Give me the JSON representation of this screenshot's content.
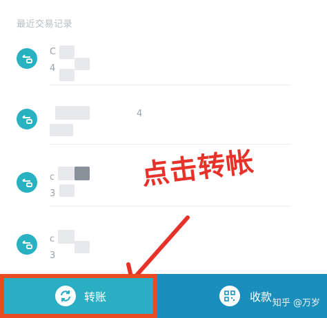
{
  "recent": {
    "title": "最近交易记录",
    "records": [
      {
        "name_fragment": "C",
        "sub_fragment": "4",
        "extra_fragment": ""
      },
      {
        "name_fragment": "",
        "sub_fragment": "",
        "extra_fragment": "4"
      },
      {
        "name_fragment": "c",
        "sub_fragment": "3",
        "extra_fragment": ""
      },
      {
        "name_fragment": "c",
        "sub_fragment": "3",
        "extra_fragment": ""
      }
    ]
  },
  "annotation": {
    "text": "点击转帐",
    "color": "#e7322a"
  },
  "bottom_bar": {
    "transfer_label": "转账",
    "receive_label": "收款",
    "transfer_color": "#2aaec4",
    "receive_color": "#1a8fbd",
    "highlight_color": "#ea4a22"
  },
  "watermark": "知乎 @万岁",
  "icons": {
    "record": "transfer-record-icon",
    "transfer": "refresh-arrows-icon",
    "receive": "qr-code-icon"
  }
}
